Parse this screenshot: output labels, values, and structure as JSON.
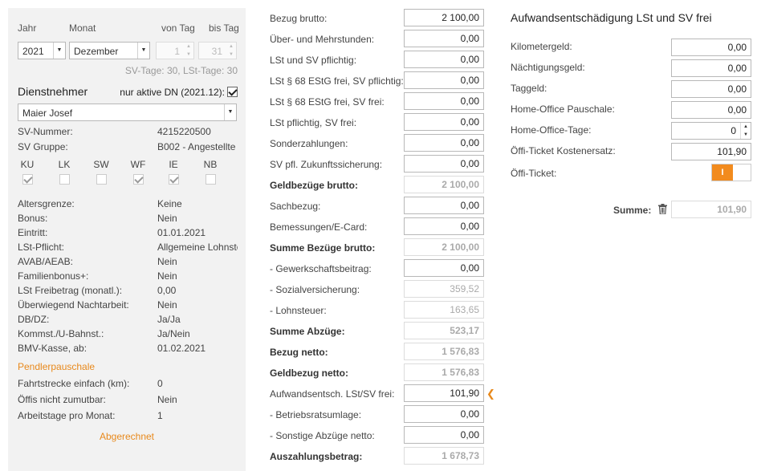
{
  "left": {
    "labels": {
      "jahr": "Jahr",
      "monat": "Monat",
      "von_tag": "von Tag",
      "bis_tag": "bis Tag"
    },
    "jahr_value": "2021",
    "monat_value": "Dezember",
    "von_tag_value": "1",
    "bis_tag_value": "31",
    "tage_info": "SV-Tage: 30,  LSt-Tage: 30",
    "dn_title": "Dienstnehmer",
    "dn_active_label": "nur aktive DN (2021.12):",
    "dn_active_checked": true,
    "dn_value": "Maier Josef",
    "sv_nummer_label": "SV-Nummer:",
    "sv_nummer_value": "4215220500",
    "sv_gruppe_label": "SV Gruppe:",
    "sv_gruppe_value": "B002 - Angestellte",
    "flags": [
      {
        "label": "KU",
        "checked": true
      },
      {
        "label": "LK",
        "checked": false
      },
      {
        "label": "SW",
        "checked": false
      },
      {
        "label": "WF",
        "checked": true
      },
      {
        "label": "IE",
        "checked": true
      },
      {
        "label": "NB",
        "checked": false
      }
    ],
    "details": [
      {
        "label": "Altersgrenze:",
        "value": "Keine"
      },
      {
        "label": "Bonus:",
        "value": "Nein"
      },
      {
        "label": "Eintritt:",
        "value": "01.01.2021"
      },
      {
        "label": "LSt-Pflicht:",
        "value": "Allgemeine Lohnsteuer"
      },
      {
        "label": "AVAB/AEAB:",
        "value": "Nein"
      },
      {
        "label": "Familienbonus+:",
        "value": "Nein"
      },
      {
        "label": "LSt Freibetrag (monatl.):",
        "value": "0,00"
      },
      {
        "label": "Überwiegend Nachtarbeit:",
        "value": "Nein"
      },
      {
        "label": "DB/DZ:",
        "value": "Ja/Ja"
      },
      {
        "label": "Kommst./U-Bahnst.:",
        "value": "Ja/Nein"
      },
      {
        "label": "BMV-Kasse, ab:",
        "value": "01.02.2021"
      }
    ],
    "pendler_title": "Pendlerpauschale",
    "pendler": [
      {
        "label": "Fahrtstrecke einfach (km):",
        "value": "0"
      },
      {
        "label": "Öffis nicht zumutbar:",
        "value": "Nein"
      },
      {
        "label": "Arbeitstage pro Monat:",
        "value": "1"
      }
    ],
    "status": "Abgerechnet"
  },
  "middle": {
    "rows": [
      {
        "label": "Bezug brutto:",
        "value": "2 100,00",
        "bold": false,
        "readonly": false
      },
      {
        "label": "Über- und Mehrstunden:",
        "value": "0,00",
        "bold": false,
        "readonly": false
      },
      {
        "label": "LSt und SV pflichtig:",
        "value": "0,00",
        "bold": false,
        "readonly": false
      },
      {
        "label": "LSt § 68 EStG frei, SV pflichtig:",
        "value": "0,00",
        "bold": false,
        "readonly": false
      },
      {
        "label": "LSt § 68 EStG frei, SV frei:",
        "value": "0,00",
        "bold": false,
        "readonly": false
      },
      {
        "label": "LSt pflichtig, SV frei:",
        "value": "0,00",
        "bold": false,
        "readonly": false
      },
      {
        "label": "Sonderzahlungen:",
        "value": "0,00",
        "bold": false,
        "readonly": false
      },
      {
        "label": "SV pfl. Zukunftssicherung:",
        "value": "0,00",
        "bold": false,
        "readonly": false
      },
      {
        "label": "Geldbezüge brutto:",
        "value": "2 100,00",
        "bold": true,
        "readonly": true
      },
      {
        "label": "Sachbezug:",
        "value": "0,00",
        "bold": false,
        "readonly": false
      },
      {
        "label": "Bemessungen/E-Card:",
        "value": "0,00",
        "bold": false,
        "readonly": false
      },
      {
        "label": "Summe Bezüge brutto:",
        "value": "2 100,00",
        "bold": true,
        "readonly": true
      },
      {
        "label": "- Gewerkschaftsbeitrag:",
        "value": "0,00",
        "bold": false,
        "readonly": false
      },
      {
        "label": "- Sozialversicherung:",
        "value": "359,52",
        "bold": false,
        "readonly": true
      },
      {
        "label": "- Lohnsteuer:",
        "value": "163,65",
        "bold": false,
        "readonly": true
      },
      {
        "label": "Summe Abzüge:",
        "value": "523,17",
        "bold": true,
        "readonly": true
      },
      {
        "label": "Bezug netto:",
        "value": "1 576,83",
        "bold": true,
        "readonly": true
      },
      {
        "label": "Geldbezug netto:",
        "value": "1 576,83",
        "bold": true,
        "readonly": true
      },
      {
        "label": "Aufwandsentsch. LSt/SV frei:",
        "value": "101,90",
        "bold": false,
        "readonly": false
      },
      {
        "label": "- Betriebsratsumlage:",
        "value": "0,00",
        "bold": false,
        "readonly": false
      },
      {
        "label": "- Sonstige Abzüge netto:",
        "value": "0,00",
        "bold": false,
        "readonly": false
      },
      {
        "label": "Auszahlungsbetrag:",
        "value": "1 678,73",
        "bold": true,
        "readonly": true
      }
    ]
  },
  "right": {
    "title": "Aufwandsentschädigung LSt und SV frei",
    "rows": [
      {
        "label": "Kilometergeld:",
        "value": "0,00"
      },
      {
        "label": "Nächtigungsgeld:",
        "value": "0,00"
      },
      {
        "label": "Taggeld:",
        "value": "0,00"
      },
      {
        "label": "Home-Office Pauschale:",
        "value": "0,00"
      },
      {
        "label": "Home-Office-Tage:",
        "value": "0"
      },
      {
        "label": "Öffi-Ticket Kostenersatz:",
        "value": "101,90"
      }
    ],
    "oeffi_ticket_label": "Öffi-Ticket:",
    "oeffi_ticket_toggle": "I",
    "summe_label": "Summe:",
    "summe_value": "101,90"
  },
  "colors": {
    "accent": "#f28b1e",
    "panel_bg": "#f2f2f2"
  }
}
